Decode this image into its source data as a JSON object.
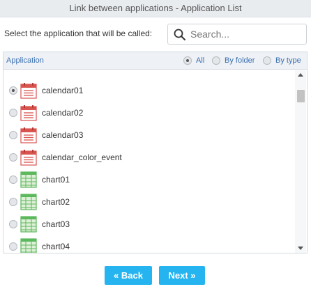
{
  "window": {
    "title": "Link between applications - Application List"
  },
  "prompt": "Select the application that will be called:",
  "search": {
    "placeholder": "Search..."
  },
  "list_header": {
    "label": "Application",
    "filters": [
      {
        "label": "All",
        "selected": true
      },
      {
        "label": "By folder",
        "selected": false
      },
      {
        "label": "By type",
        "selected": false
      }
    ]
  },
  "applications": [
    {
      "name": "calendar01",
      "icon": "calendar-icon",
      "selected": true
    },
    {
      "name": "calendar02",
      "icon": "calendar-icon",
      "selected": false
    },
    {
      "name": "calendar03",
      "icon": "calendar-icon",
      "selected": false
    },
    {
      "name": "calendar_color_event",
      "icon": "calendar-icon",
      "selected": false
    },
    {
      "name": "chart01",
      "icon": "chart-grid-icon",
      "selected": false
    },
    {
      "name": "chart02",
      "icon": "chart-grid-icon",
      "selected": false
    },
    {
      "name": "chart03",
      "icon": "chart-grid-icon",
      "selected": false
    },
    {
      "name": "chart04",
      "icon": "chart-grid-icon",
      "selected": false
    }
  ],
  "buttons": {
    "back": "« Back",
    "next": "Next »"
  },
  "colors": {
    "accent": "#25b4f0",
    "calendar": "#d9534f",
    "chart": "#5cb85c"
  }
}
